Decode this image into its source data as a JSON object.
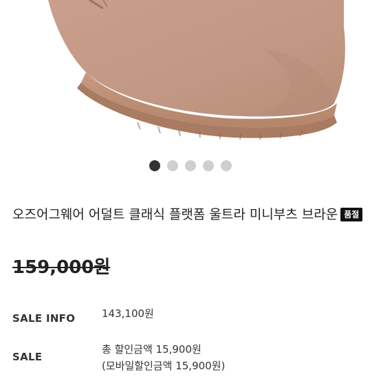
{
  "product": {
    "title": "오즈어그웨어 어덜트 클래식 플랫폼 울트라 미니부츠 브라운",
    "status_badge": "품절",
    "original_price": "159,000원"
  },
  "gallery": {
    "total_images": 5,
    "active_index": 0
  },
  "info": {
    "sale_info_label": "SALE INFO",
    "sale_info_value": "143,100원",
    "sale_label": "SALE",
    "sale_total_discount": "총 할인금액 15,900원",
    "sale_mobile_discount": "(모바일할인금액 15,900원)"
  },
  "colors": {
    "boot_suede": "#c39a86",
    "sole": "#bb8c74",
    "dot_active": "#333333",
    "dot_inactive": "#cfcfcf",
    "badge_bg": "#111111"
  }
}
